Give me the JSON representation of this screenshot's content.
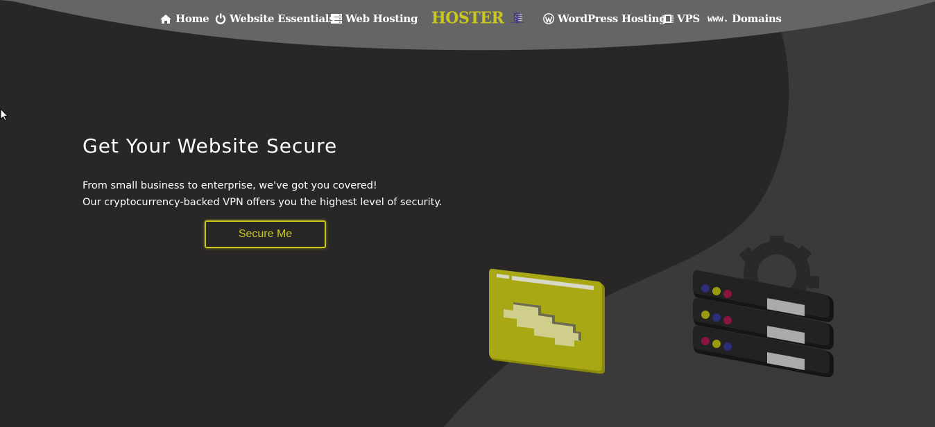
{
  "colors": {
    "background": "#292627",
    "curve": "#3b393a",
    "nav_band": "#666565",
    "accent": "#c8c81e",
    "text": "#ffffff"
  },
  "nav": {
    "left": [
      {
        "label": "Home",
        "icon": "home-icon"
      },
      {
        "label": "Website Essentials",
        "icon": "power-icon"
      },
      {
        "label": "Web Hosting",
        "icon": "server-icon"
      }
    ],
    "logo": {
      "text": "HOSTER",
      "icon": "server-rack-icon"
    },
    "right": [
      {
        "label": "WordPress Hosting",
        "icon": "wordpress-icon"
      },
      {
        "label": "VPS",
        "icon": "chip-icon"
      },
      {
        "label": "Domains",
        "prefix": "www.",
        "icon": "www-icon"
      }
    ]
  },
  "hero": {
    "title": "Get Your Website Secure",
    "line1": "From small business to enterprise, we've got you covered!",
    "line2": "Our cryptocurrency-backed VPN offers you the highest level of security.",
    "cta": "Secure Me"
  },
  "illustration": {
    "items": [
      "browser-window-illustration",
      "server-stack-illustration",
      "gear-illustration"
    ]
  }
}
